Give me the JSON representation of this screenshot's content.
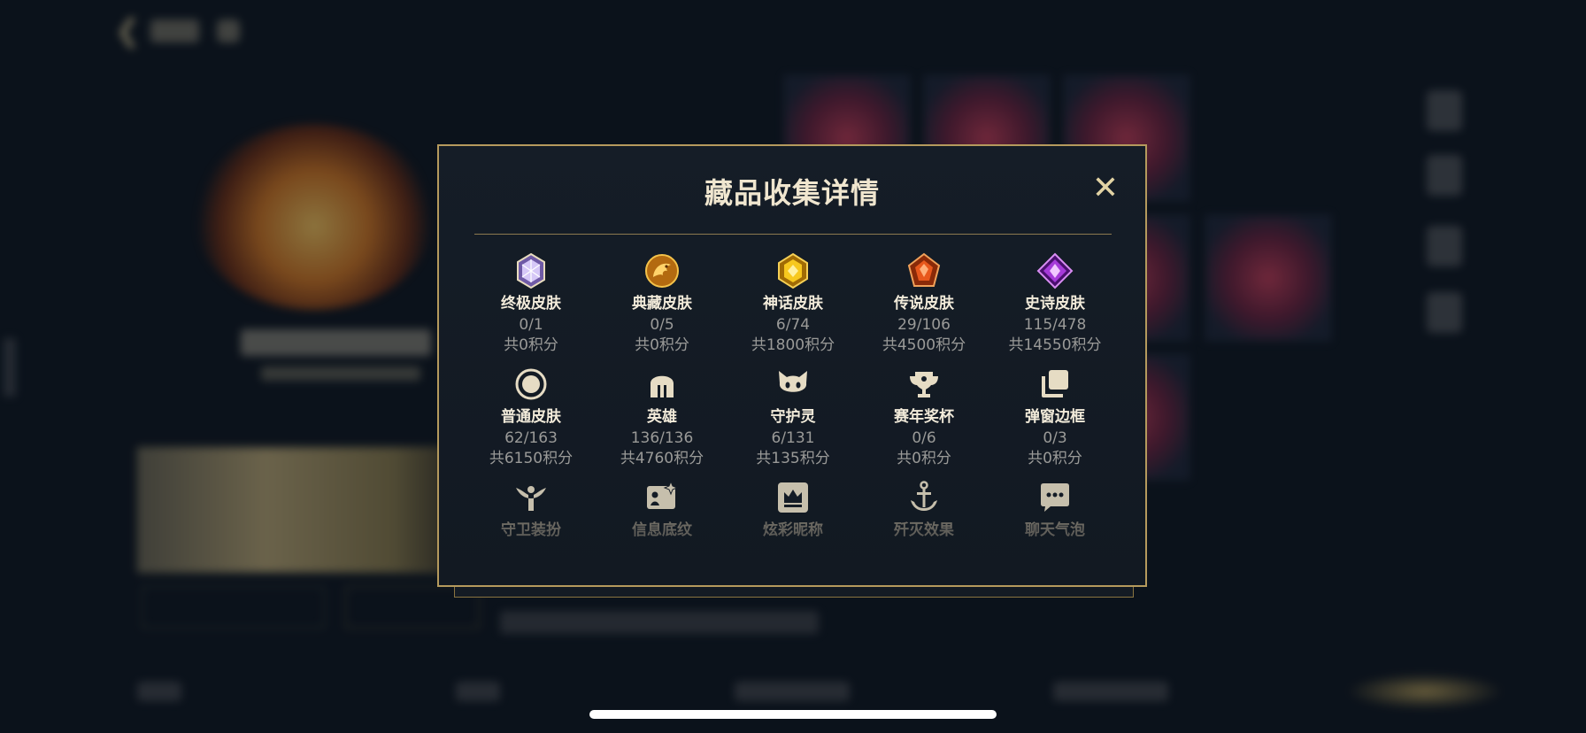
{
  "background": {
    "side_id": "44442017"
  },
  "modal": {
    "title": "藏品收集详情",
    "close_icon": "close-icon",
    "categories": [
      {
        "label": "终极皮肤",
        "count": "0/1",
        "points": "共0积分",
        "icon": "ultimate-skin-gem-icon",
        "color": "#c9b3f2"
      },
      {
        "label": "典藏皮肤",
        "count": "0/5",
        "points": "共0积分",
        "icon": "collection-dragon-icon",
        "color": "#e5a324"
      },
      {
        "label": "神话皮肤",
        "count": "6/74",
        "points": "共1800积分",
        "icon": "mythic-gem-icon",
        "color": "#f2c21b"
      },
      {
        "label": "传说皮肤",
        "count": "29/106",
        "points": "共4500积分",
        "icon": "legendary-gem-icon",
        "color": "#e2581f"
      },
      {
        "label": "史诗皮肤",
        "count": "115/478",
        "points": "共14550积分",
        "icon": "epic-gem-icon",
        "color": "#a43ad8"
      },
      {
        "label": "普通皮肤",
        "count": "62/163",
        "points": "共6150积分",
        "icon": "normal-skin-circle-icon",
        "color": "#e6dcc4"
      },
      {
        "label": "英雄",
        "count": "136/136",
        "points": "共4760积分",
        "icon": "helmet-icon",
        "color": "#e6dcc4"
      },
      {
        "label": "守护灵",
        "count": "6/131",
        "points": "共135积分",
        "icon": "guardian-spirit-icon",
        "color": "#e6dcc4"
      },
      {
        "label": "赛年奖杯",
        "count": "0/6",
        "points": "共0积分",
        "icon": "trophy-icon",
        "color": "#e6dcc4"
      },
      {
        "label": "弹窗边框",
        "count": "0/3",
        "points": "共0积分",
        "icon": "popup-frame-icon",
        "color": "#e6dcc4"
      },
      {
        "label": "守卫装扮",
        "icon": "ward-skin-icon",
        "color": "#e6dcc4"
      },
      {
        "label": "信息底纹",
        "icon": "info-card-icon",
        "color": "#e6dcc4"
      },
      {
        "label": "炫彩昵称",
        "icon": "colorful-nickname-icon",
        "color": "#e6dcc4"
      },
      {
        "label": "歼灭效果",
        "icon": "elimination-effect-icon",
        "color": "#e6dcc4"
      },
      {
        "label": "聊天气泡",
        "icon": "chat-bubble-icon",
        "color": "#e6dcc4"
      }
    ]
  }
}
